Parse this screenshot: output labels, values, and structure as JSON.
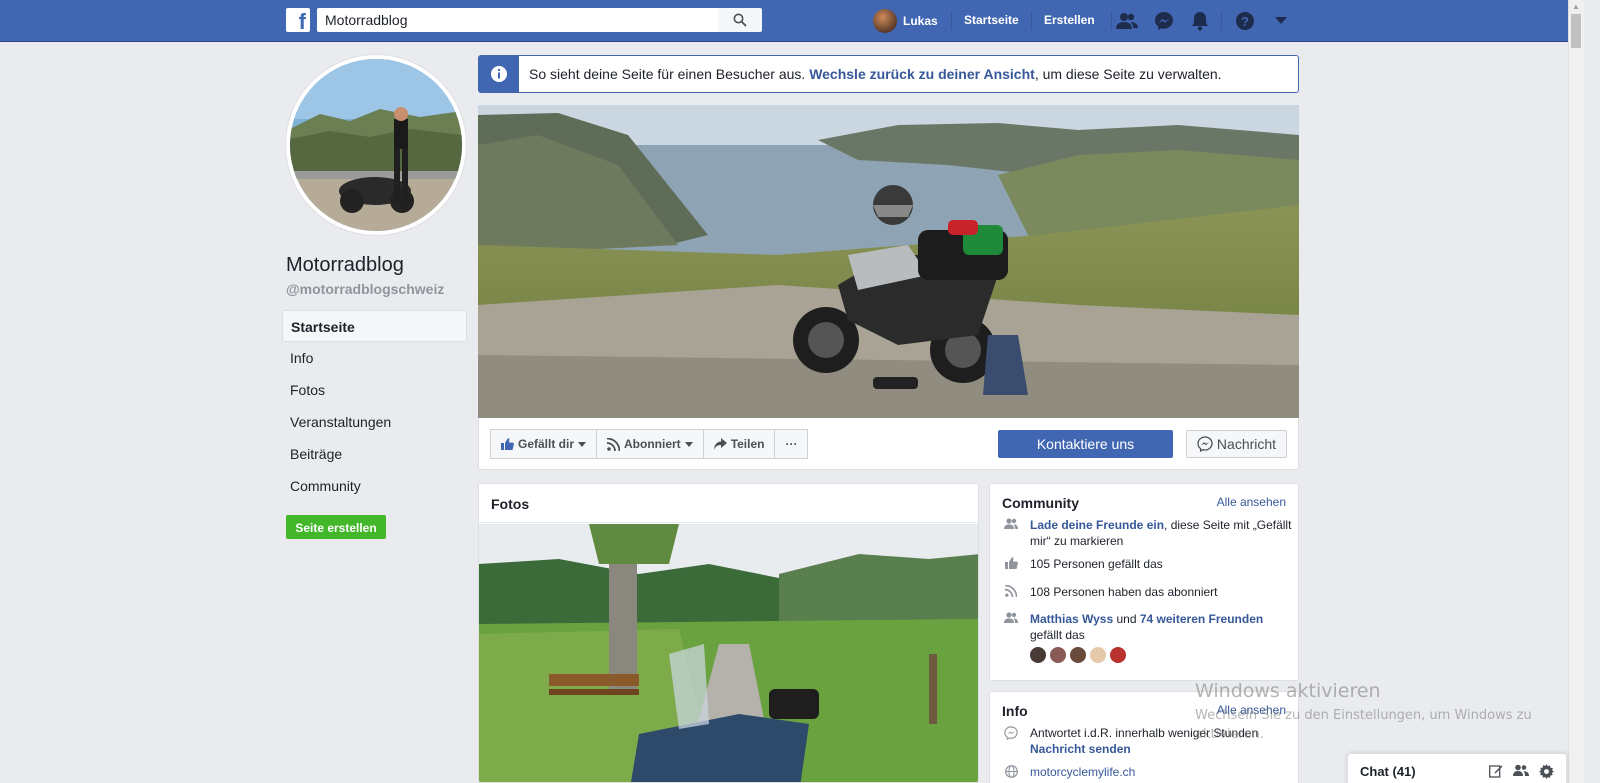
{
  "topbar": {
    "logo": "f",
    "search_value": "Motorradblog",
    "user_name": "Lukas",
    "home": "Startseite",
    "create": "Erstellen"
  },
  "banner": {
    "text_before": "So sieht deine Seite für einen Besucher aus. ",
    "link": "Wechsle zurück zu deiner Ansicht",
    "text_after": ", um diese Seite zu verwalten."
  },
  "page": {
    "name": "Motorradblog",
    "handle": "@motorradblogschweiz"
  },
  "leftnav": {
    "items": [
      {
        "label": "Startseite"
      },
      {
        "label": "Info"
      },
      {
        "label": "Fotos"
      },
      {
        "label": "Veranstaltungen"
      },
      {
        "label": "Beiträge"
      },
      {
        "label": "Community"
      }
    ],
    "create_page": "Seite erstellen"
  },
  "actions": {
    "like": "Gefällt dir",
    "follow": "Abonniert",
    "share": "Teilen",
    "more": "···",
    "contact": "Kontaktiere uns",
    "message": "Nachricht"
  },
  "photos": {
    "title": "Fotos"
  },
  "community": {
    "title": "Community",
    "see_all": "Alle ansehen",
    "invite_link": "Lade deine Freunde ein",
    "invite_text": ", diese Seite mit „Gefällt mir“ zu markieren",
    "likes": "105 Personen gefällt das",
    "followers": "108 Personen haben das abonniert",
    "friend_name": "Matthias Wyss",
    "friend_and": " und ",
    "friend_more": "74 weiteren Freunden",
    "friend_suffix": "gefällt das"
  },
  "info": {
    "title": "Info",
    "see_all": "Alle ansehen",
    "response": "Antwortet i.d.R. innerhalb weniger Stunden",
    "send_message": "Nachricht senden",
    "website": "motorcyclemylife.ch"
  },
  "chat": {
    "label": "Chat (41)"
  },
  "watermark": {
    "title": "Windows aktivieren",
    "subtitle": "Wechseln Sie zu den Einstellungen, um Windows zu aktivieren."
  },
  "colors": {
    "brand": "#4267b2",
    "link": "#365899",
    "green": "#42b72a"
  }
}
